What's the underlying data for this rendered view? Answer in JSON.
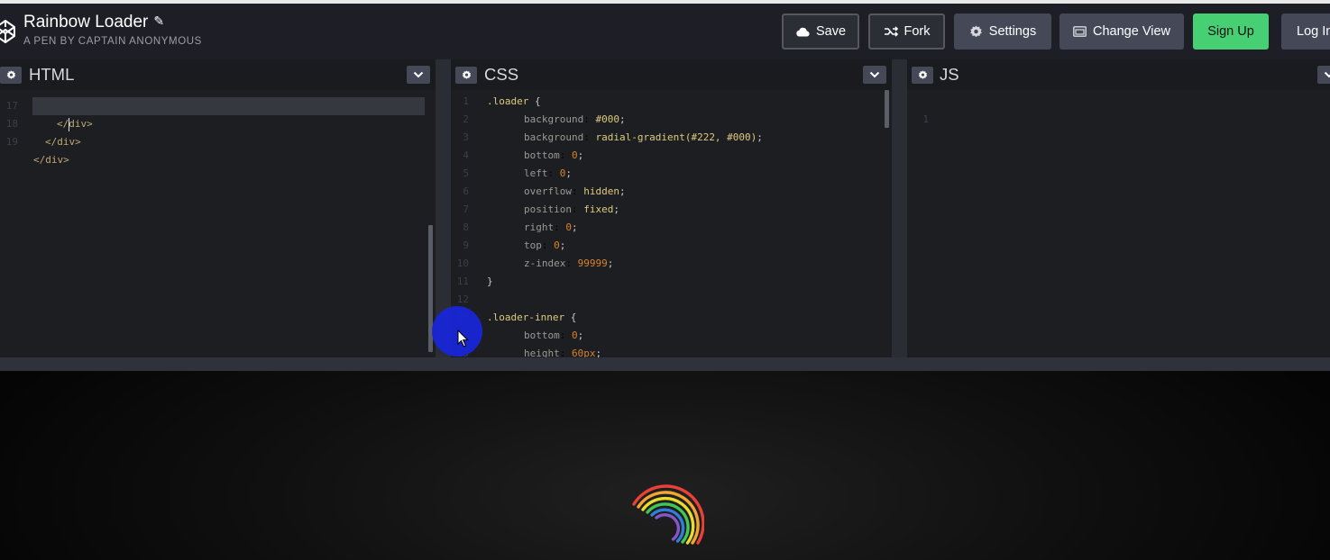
{
  "app": {
    "title": "Rainbow Loader",
    "subtitle": "A PEN BY CAPTAIN ANONYMOUS"
  },
  "toolbar": {
    "save_label": "Save",
    "fork_label": "Fork",
    "settings_label": "Settings",
    "change_view_label": "Change View",
    "signup_label": "Sign Up",
    "login_label": "Log In"
  },
  "editors": {
    "html": {
      "title": "HTML",
      "lines": [
        {
          "n": "17",
          "text": "</div>"
        },
        {
          "n": "18",
          "text": "</div>"
        },
        {
          "n": "19",
          "text": "</div>"
        }
      ]
    },
    "css": {
      "title": "CSS",
      "lines": [
        {
          "n": "1",
          "sel": ".loader",
          "punc": "{"
        },
        {
          "n": "2",
          "prop": "background",
          "val": "#000",
          "end": ";"
        },
        {
          "n": "3",
          "prop": "background",
          "val": "radial-gradient(#222, #000)",
          "end": ";"
        },
        {
          "n": "4",
          "prop": "bottom",
          "num": "0",
          "end": ";"
        },
        {
          "n": "5",
          "prop": "left",
          "num": "0",
          "end": ";"
        },
        {
          "n": "6",
          "prop": "overflow",
          "val": "hidden",
          "end": ";"
        },
        {
          "n": "7",
          "prop": "position",
          "val": "fixed",
          "end": ";"
        },
        {
          "n": "8",
          "prop": "right",
          "num": "0",
          "end": ";"
        },
        {
          "n": "9",
          "prop": "top",
          "num": "0",
          "end": ";"
        },
        {
          "n": "10",
          "prop": "z-index",
          "num": "99999",
          "end": ";"
        },
        {
          "n": "11",
          "punc": "}"
        },
        {
          "n": "12"
        },
        {
          "n": "13",
          "sel": ".loader-inner",
          "punc": "{"
        },
        {
          "n": "14",
          "prop": "bottom",
          "num": "0",
          "end": ";"
        },
        {
          "n": "15",
          "prop": "height",
          "num": "60px",
          "end": ";"
        }
      ]
    },
    "js": {
      "title": "JS",
      "lines": [
        {
          "n": "1"
        }
      ]
    }
  },
  "colors": {
    "header_bg": "#1e1f26",
    "signup_green": "#47cf73",
    "rainbow": [
      "#e8413a",
      "#f2a533",
      "#eadb2f",
      "#43c655",
      "#2f7ed8",
      "#8456c9"
    ]
  },
  "icons": [
    "codepen-logo-icon",
    "pencil-icon",
    "cloud-icon",
    "fork-icon",
    "gear-icon",
    "change-view-icon",
    "chevron-down-icon",
    "mouse-cursor-icon"
  ]
}
